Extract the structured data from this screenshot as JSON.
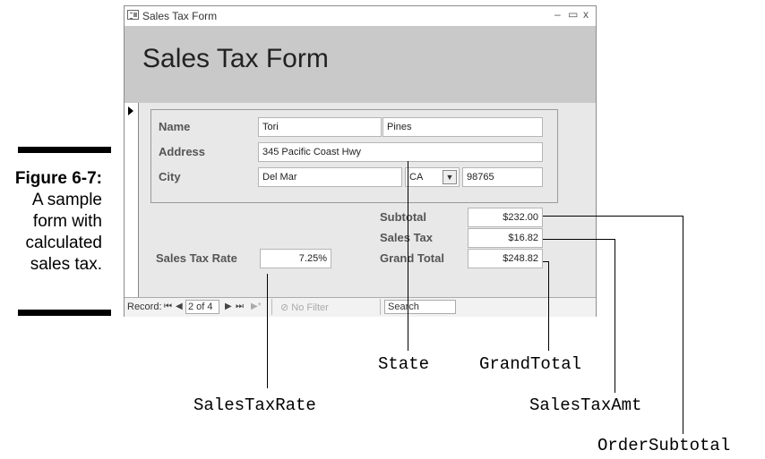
{
  "figure": {
    "number": "Figure 6-7:",
    "caption_lines": [
      "A sample",
      "form with",
      "calculated",
      "sales tax."
    ]
  },
  "window": {
    "title": "Sales Tax Form",
    "controls": {
      "minimize": "–",
      "maximize": "▭",
      "close": "x"
    }
  },
  "form": {
    "header_title": "Sales Tax Form",
    "labels": {
      "name": "Name",
      "address": "Address",
      "city": "City",
      "subtotal": "Subtotal",
      "sales_tax": "Sales Tax",
      "sales_tax_rate": "Sales Tax Rate",
      "grand_total": "Grand Total"
    },
    "values": {
      "first_name": "Tori",
      "last_name": "Pines",
      "address": "345 Pacific Coast Hwy",
      "city": "Del Mar",
      "state": "CA",
      "zip": "98765",
      "subtotal": "$232.00",
      "sales_tax": "$16.82",
      "sales_tax_rate": "7.25%",
      "grand_total": "$248.82"
    }
  },
  "navigation": {
    "record_label": "Record:",
    "first": "⏮",
    "prev": "◀",
    "current": "2 of 4",
    "next": "▶",
    "last": "⏭",
    "new": "▶*",
    "filter_label": "No Filter",
    "search_label": "Search"
  },
  "callouts": {
    "state": "State",
    "grand_total": "GrandTotal",
    "sales_tax_rate": "SalesTaxRate",
    "sales_tax_amt": "SalesTaxAmt",
    "order_subtotal": "OrderSubtotal"
  }
}
